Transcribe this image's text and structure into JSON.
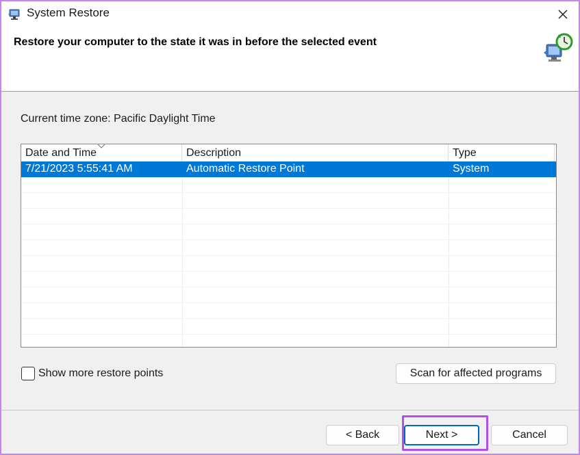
{
  "window": {
    "title": "System Restore",
    "icon": "system-restore-icon",
    "close_icon": "close-icon"
  },
  "header": {
    "title": "Restore your computer to the state it was in before the selected event",
    "icon": "restore-clock-icon"
  },
  "timezone": "Current time zone: Pacific Daylight Time",
  "table": {
    "columns": [
      "Date and Time",
      "Description",
      "Type"
    ],
    "sorted_column": "Date and Time",
    "rows": [
      {
        "date": "7/21/2023 5:55:41 AM",
        "description": "Automatic Restore Point",
        "type": "System",
        "selected": true
      }
    ]
  },
  "show_more": {
    "label": "Show more restore points",
    "checked": false
  },
  "buttons": {
    "scan": "Scan for affected programs",
    "back": "< Back",
    "next": "Next >",
    "cancel": "Cancel"
  },
  "colors": {
    "selection": "#0078d7",
    "highlight_border": "#b150e8",
    "window_border": "#c583f3",
    "primary_button_border": "#0067c0"
  }
}
